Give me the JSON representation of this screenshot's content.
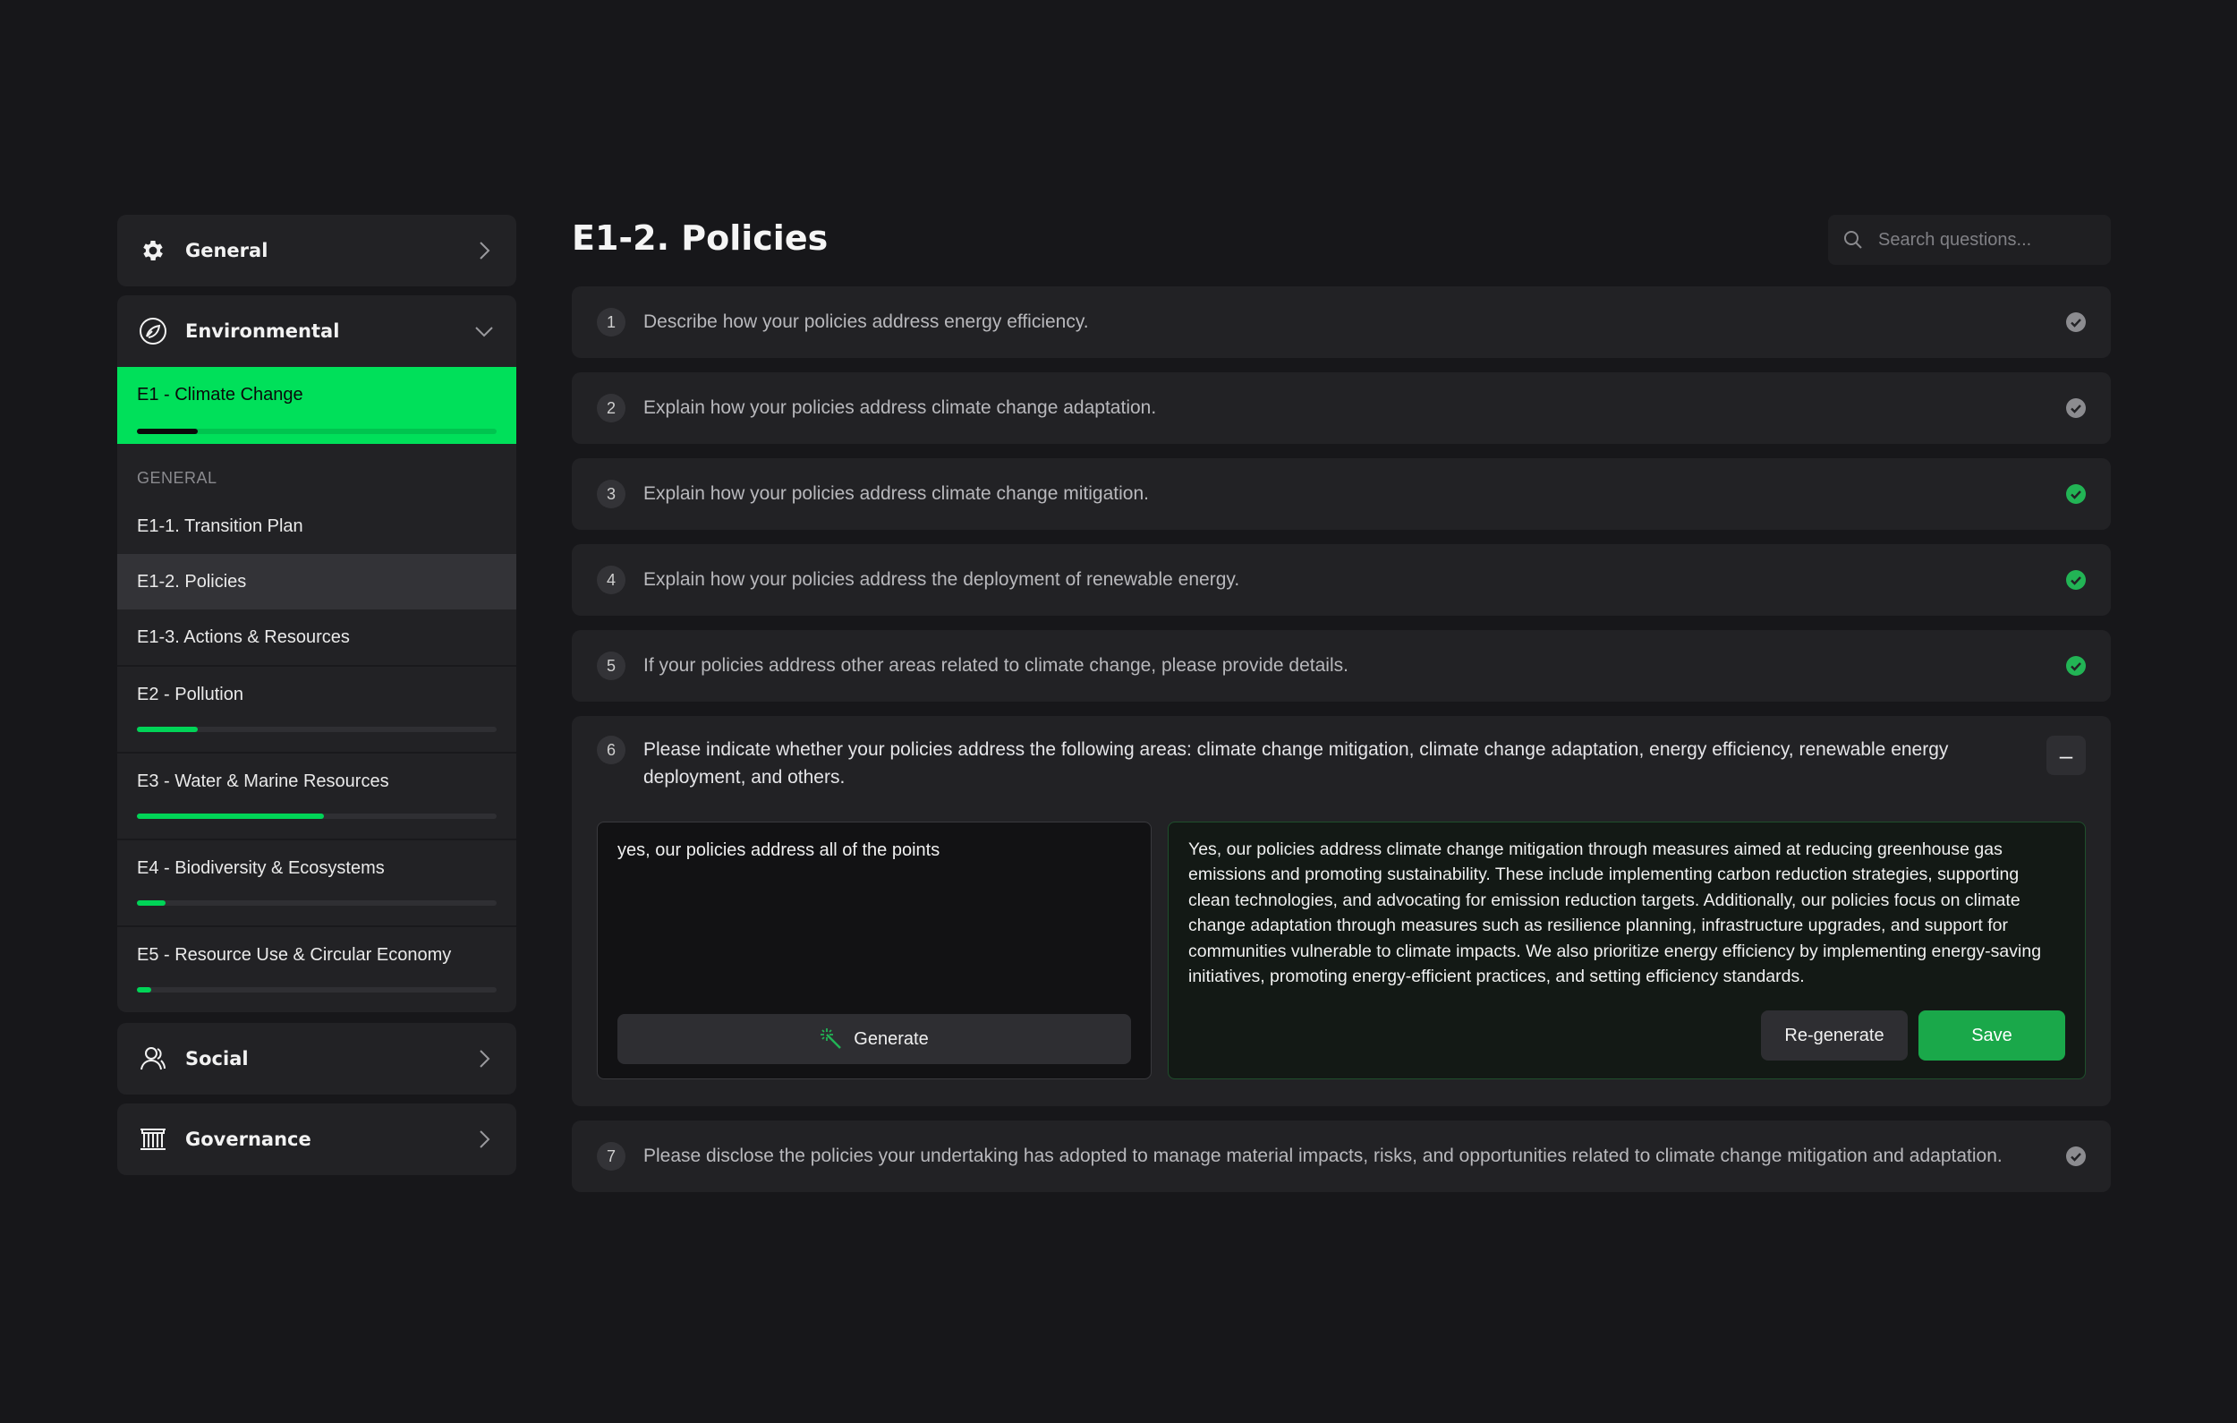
{
  "sidebar": {
    "general": {
      "label": "General",
      "icon": "gear-icon"
    },
    "environmental": {
      "label": "Environmental",
      "icon": "leaf-globe-icon",
      "active_sub": {
        "label": "E1 - Climate Change",
        "progress": 0.17
      },
      "section_header": "GENERAL",
      "items": [
        {
          "label": "E1-1. Transition Plan"
        },
        {
          "label": "E1-2. Policies",
          "selected": true
        },
        {
          "label": "E1-3. Actions & Resources"
        }
      ],
      "subcategories": [
        {
          "label": "E2 - Pollution",
          "progress": 0.17
        },
        {
          "label": "E3 - Water & Marine Resources",
          "progress": 0.52
        },
        {
          "label": "E4 - Biodiversity & Ecosystems",
          "progress": 0.08
        },
        {
          "label": "E5 - Resource Use & Circular Economy",
          "progress": 0.04
        }
      ]
    },
    "social": {
      "label": "Social",
      "icon": "user-icon"
    },
    "governance": {
      "label": "Governance",
      "icon": "building-icon"
    }
  },
  "main": {
    "title": "E1-2. Policies",
    "search_placeholder": "Search questions...",
    "questions": [
      {
        "num": "1",
        "text": "Describe how your policies address energy efficiency.",
        "status": "done-grey"
      },
      {
        "num": "2",
        "text": "Explain how your policies address climate change adaptation.",
        "status": "done-grey"
      },
      {
        "num": "3",
        "text": "Explain how your policies address climate change mitigation.",
        "status": "done-green"
      },
      {
        "num": "4",
        "text": "Explain how your policies address the deployment of renewable energy.",
        "status": "done-green"
      },
      {
        "num": "5",
        "text": "If your policies address other areas related to climate change, please provide details.",
        "status": "done-green"
      }
    ],
    "expanded": {
      "num": "6",
      "text": "Please indicate whether your policies address the following areas: climate change mitigation, climate change adaptation, energy efficiency, renewable energy deployment, and others.",
      "collapse_label": "–",
      "input_value": "yes, our policies address all of the points",
      "generate_label": "Generate",
      "output_text": "Yes, our policies address climate change mitigation through measures aimed at reducing greenhouse gas emissions and promoting sustainability. These include implementing carbon reduction strategies, supporting clean technologies, and advocating for emission reduction targets. Additionally, our policies focus on climate change adaptation through measures such as resilience planning, infrastructure upgrades, and support for communities vulnerable to climate impacts. We also prioritize energy efficiency by implementing energy-saving initiatives, promoting energy-efficient practices, and setting efficiency standards.",
      "regenerate_label": "Re-generate",
      "save_label": "Save"
    },
    "last_question": {
      "num": "7",
      "text": "Please disclose the policies your undertaking has adopted to manage material impacts, risks, and opportunities related to climate change mitigation and adaptation.",
      "status": "done-grey"
    }
  },
  "colors": {
    "accent": "#00e05a",
    "save": "#1aa84a",
    "check_green": "#22b455",
    "check_grey": "#8c8c90"
  }
}
